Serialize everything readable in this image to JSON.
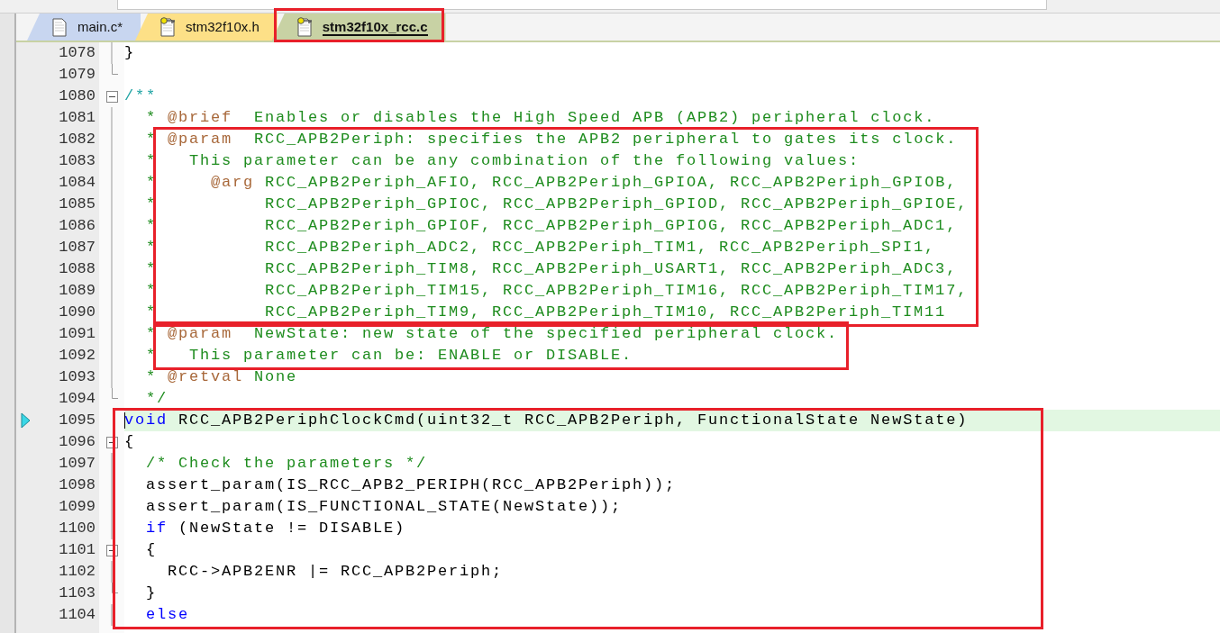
{
  "tabs": [
    {
      "label": "main.c*",
      "selected": false,
      "read_only": false,
      "color": "#c8d6f0",
      "outlined": false
    },
    {
      "label": "stm32f10x.h",
      "selected": false,
      "read_only": true,
      "color": "#fde087",
      "outlined": false
    },
    {
      "label": "stm32f10x_rcc.c",
      "selected": true,
      "read_only": true,
      "color": "#c8d2a4",
      "outlined": true
    }
  ],
  "blocks": [
    {
      "highlighted": false,
      "lines": [
        {
          "number": "1078",
          "current": false,
          "fold_toggle": false,
          "fold_guide": true,
          "fold_end": false,
          "tokens": [
            {
              "kind": "plain",
              "text": "}"
            }
          ]
        },
        {
          "number": "1079",
          "current": false,
          "fold_toggle": false,
          "fold_guide": false,
          "fold_end": true
        },
        {
          "number": "1080",
          "current": false,
          "fold_toggle": true,
          "fold_guide": false,
          "fold_end": false,
          "tokens": [
            {
              "kind": "doc",
              "text": "/**"
            }
          ]
        },
        {
          "number": "1081",
          "current": false,
          "fold_toggle": false,
          "fold_guide": true,
          "fold_end": false,
          "tokens": [
            {
              "kind": "comment",
              "text": "  * "
            },
            {
              "kind": "tag",
              "text": "@brief"
            },
            {
              "kind": "comment",
              "text": "  Enables or disables the High Speed APB (APB2) peripheral clock."
            }
          ]
        }
      ]
    },
    {
      "highlighted": true,
      "lines": [
        {
          "number": "1082",
          "current": false,
          "fold_toggle": false,
          "fold_guide": true,
          "fold_end": false,
          "tokens": [
            {
              "kind": "comment",
              "text": "  * "
            },
            {
              "kind": "tag",
              "text": "@param"
            },
            {
              "kind": "comment",
              "text": "  RCC_APB2Periph: specifies the APB2 peripheral to gates its clock."
            }
          ]
        },
        {
          "number": "1083",
          "current": false,
          "fold_toggle": false,
          "fold_guide": true,
          "fold_end": false,
          "tokens": [
            {
              "kind": "comment",
              "text": "  *   This parameter can be any combination of the following values:"
            }
          ]
        },
        {
          "number": "1084",
          "current": false,
          "fold_toggle": false,
          "fold_guide": true,
          "fold_end": false,
          "tokens": [
            {
              "kind": "comment",
              "text": "  *     "
            },
            {
              "kind": "tag",
              "text": "@arg"
            },
            {
              "kind": "comment",
              "text": " RCC_APB2Periph_AFIO, RCC_APB2Periph_GPIOA, RCC_APB2Periph_GPIOB,"
            }
          ]
        },
        {
          "number": "1085",
          "current": false,
          "fold_toggle": false,
          "fold_guide": true,
          "fold_end": false,
          "tokens": [
            {
              "kind": "comment",
              "text": "  *          RCC_APB2Periph_GPIOC, RCC_APB2Periph_GPIOD, RCC_APB2Periph_GPIOE,"
            }
          ]
        },
        {
          "number": "1086",
          "current": false,
          "fold_toggle": false,
          "fold_guide": true,
          "fold_end": false,
          "tokens": [
            {
              "kind": "comment",
              "text": "  *          RCC_APB2Periph_GPIOF, RCC_APB2Periph_GPIOG, RCC_APB2Periph_ADC1,"
            }
          ]
        },
        {
          "number": "1087",
          "current": false,
          "fold_toggle": false,
          "fold_guide": true,
          "fold_end": false,
          "tokens": [
            {
              "kind": "comment",
              "text": "  *          RCC_APB2Periph_ADC2, RCC_APB2Periph_TIM1, RCC_APB2Periph_SPI1,"
            }
          ]
        },
        {
          "number": "1088",
          "current": false,
          "fold_toggle": false,
          "fold_guide": true,
          "fold_end": false,
          "tokens": [
            {
              "kind": "comment",
              "text": "  *          RCC_APB2Periph_TIM8, RCC_APB2Periph_USART1, RCC_APB2Periph_ADC3,"
            }
          ]
        },
        {
          "number": "1089",
          "current": false,
          "fold_toggle": false,
          "fold_guide": true,
          "fold_end": false,
          "tokens": [
            {
              "kind": "comment",
              "text": "  *          RCC_APB2Periph_TIM15, RCC_APB2Periph_TIM16, RCC_APB2Periph_TIM17,"
            }
          ]
        },
        {
          "number": "1090",
          "current": false,
          "fold_toggle": false,
          "fold_guide": true,
          "fold_end": false,
          "tokens": [
            {
              "kind": "comment",
              "text": "  *          RCC_APB2Periph_TIM9, RCC_APB2Periph_TIM10, RCC_APB2Periph_TIM11"
            }
          ]
        }
      ]
    },
    {
      "highlighted": true,
      "lines": [
        {
          "number": "1091",
          "current": false,
          "fold_toggle": false,
          "fold_guide": true,
          "fold_end": false,
          "tokens": [
            {
              "kind": "comment",
              "text": "  * "
            },
            {
              "kind": "tag",
              "text": "@param"
            },
            {
              "kind": "comment",
              "text": "  NewState: new state of the specified peripheral clock."
            }
          ]
        },
        {
          "number": "1092",
          "current": false,
          "fold_toggle": false,
          "fold_guide": true,
          "fold_end": false,
          "tokens": [
            {
              "kind": "comment",
              "text": "  *   This parameter can be: ENABLE or DISABLE."
            }
          ]
        }
      ]
    },
    {
      "highlighted": false,
      "lines": [
        {
          "number": "1093",
          "current": false,
          "fold_toggle": false,
          "fold_guide": true,
          "fold_end": false,
          "tokens": [
            {
              "kind": "comment",
              "text": "  * "
            },
            {
              "kind": "tag",
              "text": "@retval"
            },
            {
              "kind": "comment",
              "text": " None"
            }
          ]
        },
        {
          "number": "1094",
          "current": false,
          "fold_toggle": false,
          "fold_guide": false,
          "fold_end": true,
          "tokens": [
            {
              "kind": "comment",
              "text": "  */"
            }
          ]
        }
      ]
    },
    {
      "highlighted": true,
      "lines": [
        {
          "number": "1095",
          "current": true,
          "fold_toggle": false,
          "fold_guide": false,
          "fold_end": false,
          "tokens": [
            {
              "kind": "keyword",
              "text": "void"
            },
            {
              "kind": "plain",
              "text": " RCC_APB2PeriphClockCmd(uint32_t RCC_APB2Periph, FunctionalState NewState)"
            }
          ]
        },
        {
          "number": "1096",
          "current": false,
          "fold_toggle": true,
          "fold_guide": false,
          "fold_end": false,
          "tokens": [
            {
              "kind": "plain",
              "text": "{"
            }
          ]
        },
        {
          "number": "1097",
          "current": false,
          "fold_toggle": false,
          "fold_guide": true,
          "fold_end": false,
          "tokens": [
            {
              "kind": "comment",
              "text": "  /* Check the parameters */"
            }
          ]
        },
        {
          "number": "1098",
          "current": false,
          "fold_toggle": false,
          "fold_guide": true,
          "fold_end": false,
          "tokens": [
            {
              "kind": "plain",
              "text": "  assert_param(IS_RCC_APB2_PERIPH(RCC_APB2Periph));"
            }
          ]
        },
        {
          "number": "1099",
          "current": false,
          "fold_toggle": false,
          "fold_guide": true,
          "fold_end": false,
          "tokens": [
            {
              "kind": "plain",
              "text": "  assert_param(IS_FUNCTIONAL_STATE(NewState));"
            }
          ]
        },
        {
          "number": "1100",
          "current": false,
          "fold_toggle": false,
          "fold_guide": true,
          "fold_end": false,
          "tokens": [
            {
              "kind": "keyword",
              "text": "  if"
            },
            {
              "kind": "plain",
              "text": " (NewState != DISABLE)"
            }
          ]
        },
        {
          "number": "1101",
          "current": false,
          "fold_toggle": true,
          "fold_guide": false,
          "fold_end": false,
          "tokens": [
            {
              "kind": "plain",
              "text": "  {"
            }
          ]
        },
        {
          "number": "1102",
          "current": false,
          "fold_toggle": false,
          "fold_guide": true,
          "fold_end": false,
          "tokens": [
            {
              "kind": "plain",
              "text": "    RCC->APB2ENR |= RCC_APB2Periph;"
            }
          ]
        },
        {
          "number": "1103",
          "current": false,
          "fold_toggle": false,
          "fold_guide": false,
          "fold_end": true,
          "tokens": [
            {
              "kind": "plain",
              "text": "  }"
            }
          ]
        },
        {
          "number": "1104",
          "current": false,
          "fold_toggle": false,
          "fold_guide": true,
          "fold_end": false,
          "tokens": [
            {
              "kind": "keyword",
              "text": "  else"
            }
          ]
        }
      ]
    }
  ]
}
